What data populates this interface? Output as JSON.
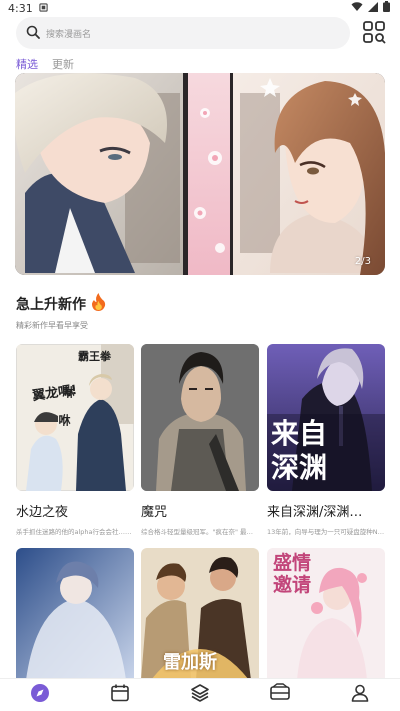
{
  "status_bar": {
    "time": "4:31"
  },
  "search": {
    "placeholder": "搜索漫画名"
  },
  "tabs": [
    {
      "label": "精选",
      "active": true
    },
    {
      "label": "更新",
      "active": false
    }
  ],
  "banner": {
    "page_indicator": "2/3"
  },
  "section": {
    "title": "急上升新作",
    "subtitle": "精彩新作早看早享受"
  },
  "cards": [
    {
      "title": "水边之夜",
      "desc": "杀手抓住迷路的他的alpha行会会社……",
      "cover_text": [
        "翼龙嗎!",
        "霸王拳",
        "咻",
        "咻"
      ]
    },
    {
      "title": "魔咒",
      "desc": "综合格斗轻型量级冠军。\"疯在奈\" 最……",
      "cover_text": []
    },
    {
      "title": "来自深渊/深渊…",
      "desc": "13年前，向导与理为一只可疑盘旋种Ni……",
      "cover_text": [
        "来自",
        "深渊"
      ]
    }
  ],
  "cards_row2": [
    {
      "cover_text": []
    },
    {
      "cover_text": [
        "雷加斯"
      ]
    },
    {
      "cover_text": [
        "盛情",
        "邀请"
      ]
    }
  ],
  "colors": {
    "accent": "#7a5bd6",
    "active_tab": "#7a5bd6",
    "inactive_tab": "#999999"
  },
  "nav": [
    {
      "name": "discover",
      "icon": "compass-icon",
      "active": true
    },
    {
      "name": "calendar",
      "icon": "calendar-icon",
      "active": false
    },
    {
      "name": "library",
      "icon": "layers-icon",
      "active": false
    },
    {
      "name": "ranking",
      "icon": "ticket-icon",
      "active": false
    },
    {
      "name": "profile",
      "icon": "person-icon",
      "active": false
    }
  ]
}
